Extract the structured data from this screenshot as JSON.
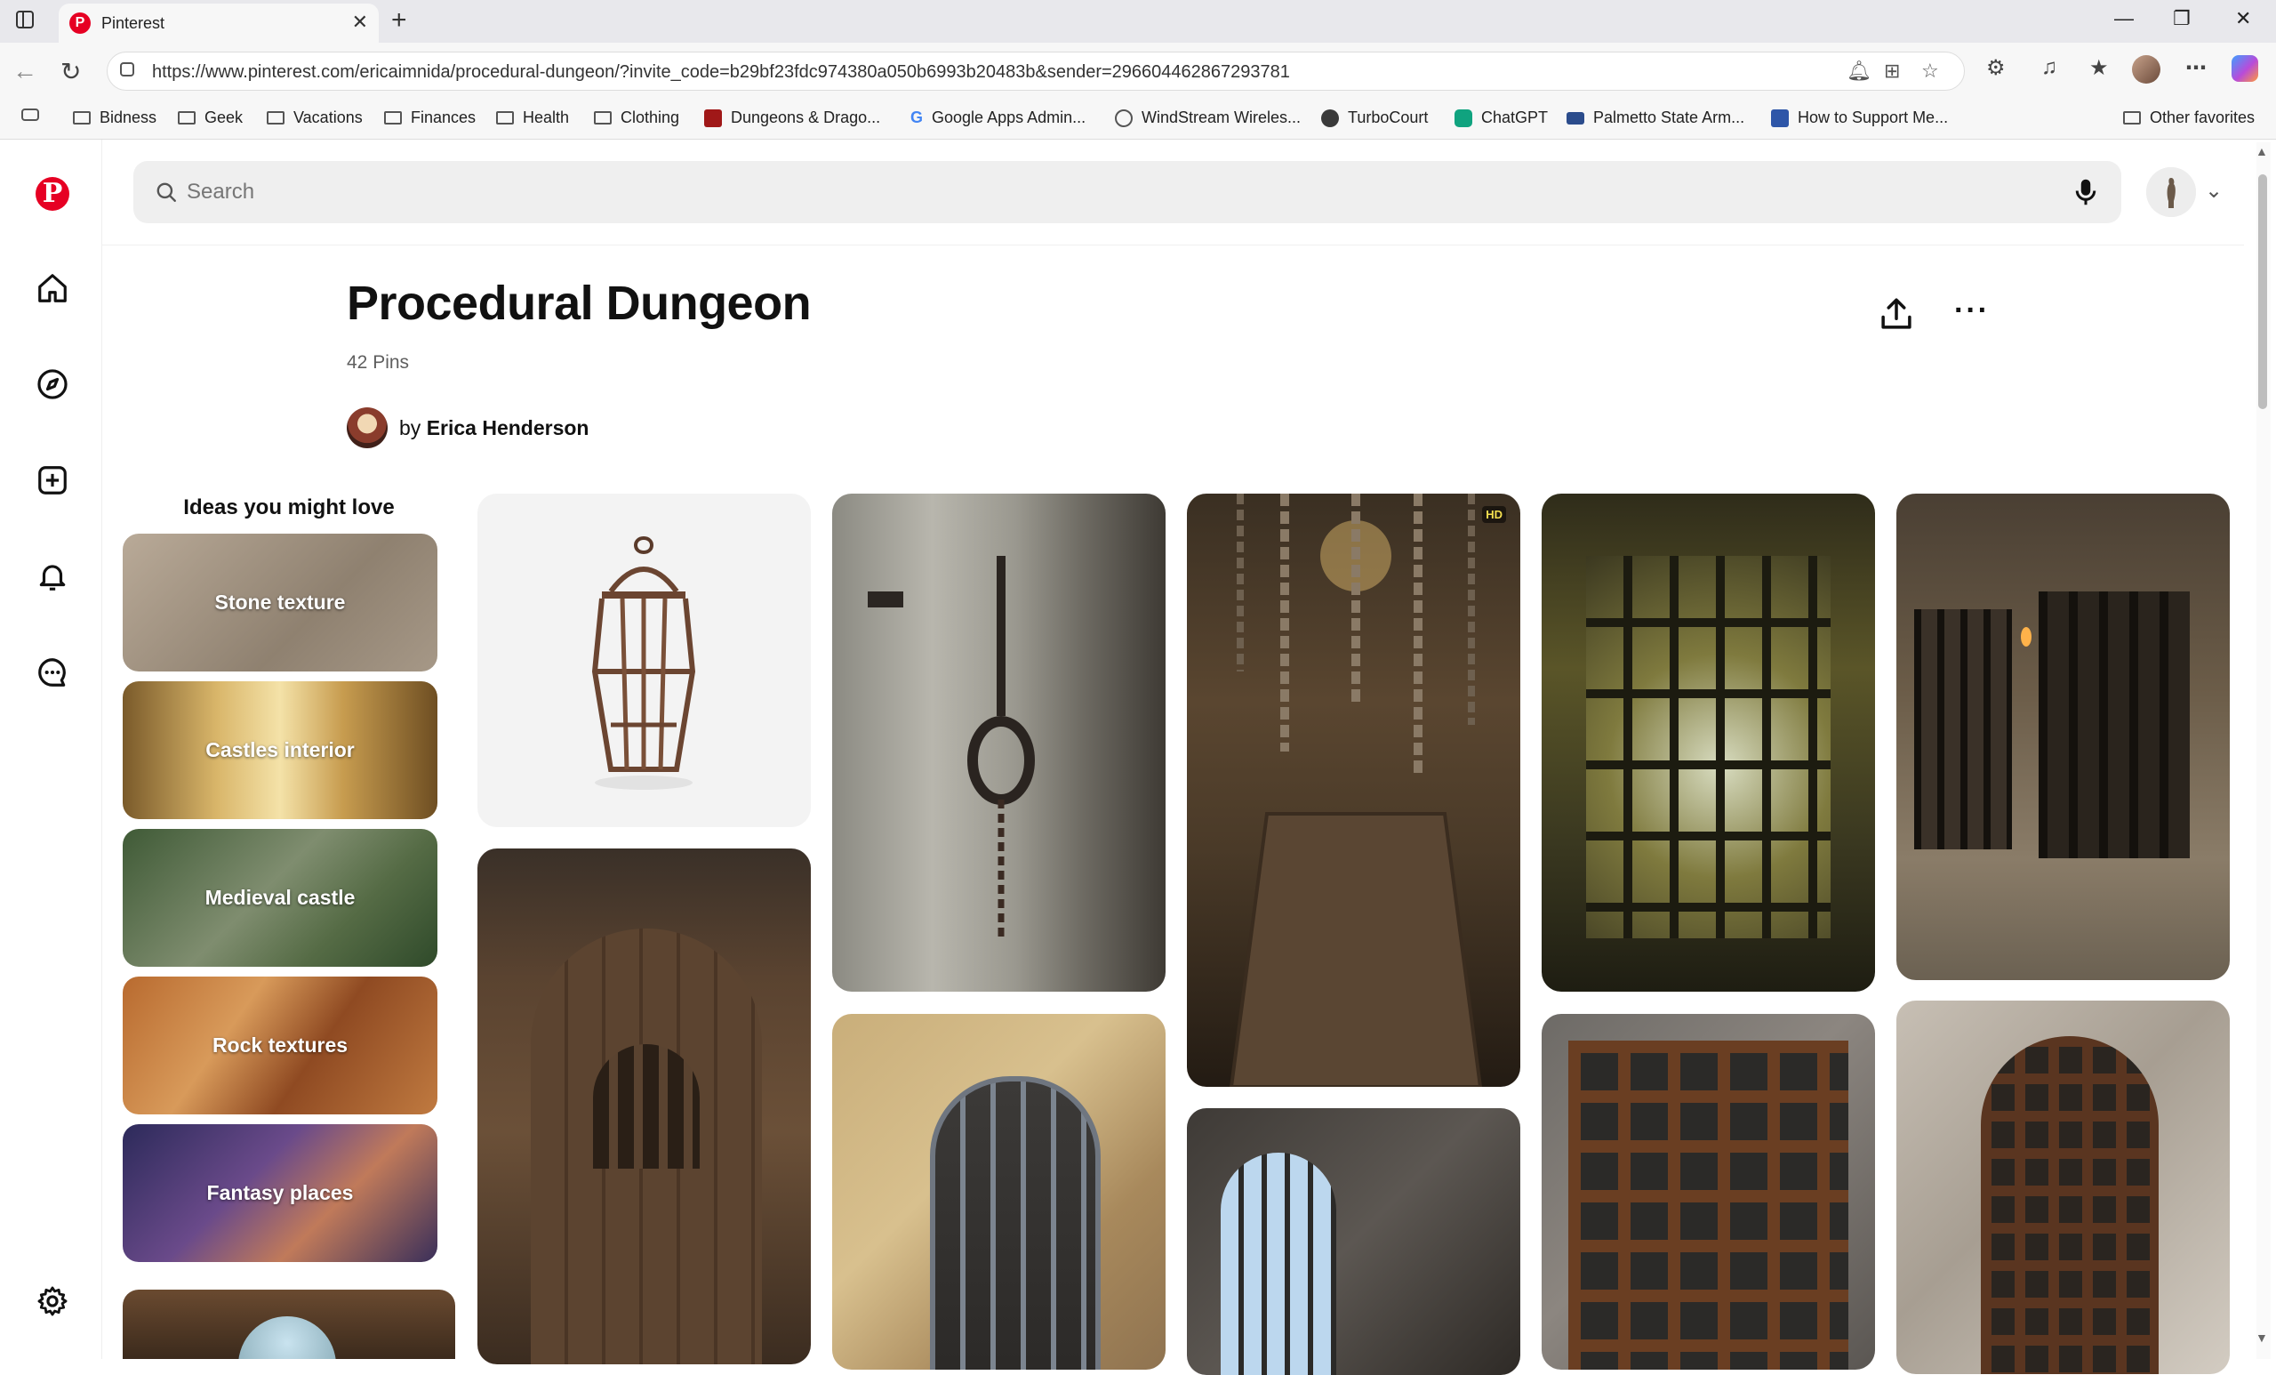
{
  "browser": {
    "tab_title": "Pinterest",
    "tab_close": "✕",
    "new_tab": "+",
    "url": "https://www.pinterest.com/ericaimnida/procedural-dungeon/?invite_code=b29bf23fdc974380a050b6993b20483b&sender=296604462867293781",
    "favorites": [
      {
        "label": "Bidness",
        "icon": "folder-icon"
      },
      {
        "label": "Geek",
        "icon": "folder-icon"
      },
      {
        "label": "Vacations",
        "icon": "folder-icon"
      },
      {
        "label": "Finances",
        "icon": "folder-icon"
      },
      {
        "label": "Health",
        "icon": "folder-icon"
      },
      {
        "label": "Clothing",
        "icon": "folder-icon"
      },
      {
        "label": "Dungeons & Drago...",
        "icon": "dnd-icon"
      },
      {
        "label": "Google Apps Admin...",
        "icon": "google-icon"
      },
      {
        "label": "WindStream Wireles...",
        "icon": "globe-icon"
      },
      {
        "label": "TurboCourt",
        "icon": "turbocourt-icon"
      },
      {
        "label": "ChatGPT",
        "icon": "chatgpt-icon"
      },
      {
        "label": "Palmetto State Arm...",
        "icon": "psa-icon"
      },
      {
        "label": "How to Support Me...",
        "icon": "drax-icon"
      }
    ],
    "other_favorites": "Other favorites"
  },
  "search": {
    "placeholder": "Search"
  },
  "board": {
    "title": "Procedural Dungeon",
    "pin_count": "42 Pins",
    "by": "by",
    "owner": "Erica Henderson"
  },
  "ideas": {
    "heading": "Ideas you might love",
    "items": [
      {
        "label": "Stone texture"
      },
      {
        "label": "Castles interior"
      },
      {
        "label": "Medieval castle"
      },
      {
        "label": "Rock textures"
      },
      {
        "label": "Fantasy places"
      }
    ]
  },
  "pins": {
    "hd_badge": "HD"
  },
  "colors": {
    "brand": "#e60023",
    "search_bg": "#efefef"
  }
}
